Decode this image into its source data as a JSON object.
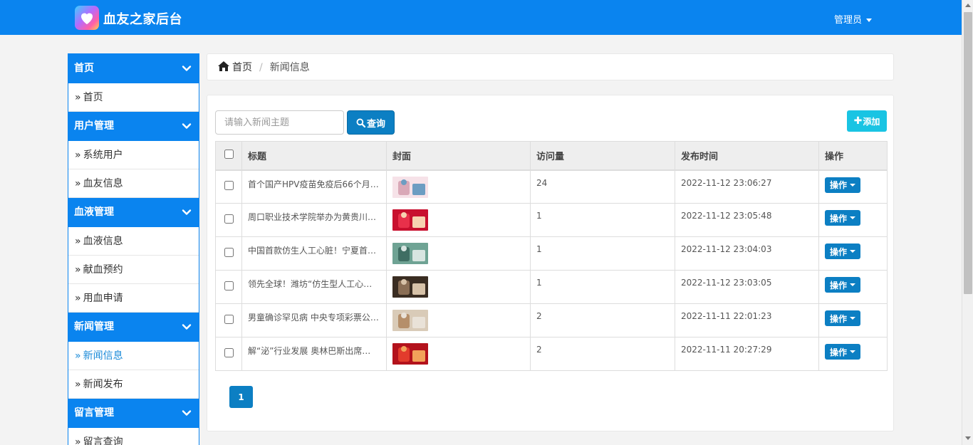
{
  "header": {
    "brand": "血友之家后台",
    "admin_label": "管理员"
  },
  "sidebar": {
    "sections": [
      {
        "title": "首页",
        "items": [
          {
            "label": "首页"
          }
        ]
      },
      {
        "title": "用户管理",
        "items": [
          {
            "label": "系统用户"
          },
          {
            "label": "血友信息"
          }
        ]
      },
      {
        "title": "血液管理",
        "items": [
          {
            "label": "血液信息"
          },
          {
            "label": "献血预约"
          },
          {
            "label": "用血申请"
          }
        ]
      },
      {
        "title": "新闻管理",
        "items": [
          {
            "label": "新闻信息"
          },
          {
            "label": "新闻发布"
          }
        ]
      },
      {
        "title": "留言管理",
        "items": [
          {
            "label": "留言查询"
          }
        ]
      }
    ],
    "item_prefix": "»"
  },
  "breadcrumb": {
    "home": "首页",
    "current": "新闻信息"
  },
  "toolbar": {
    "search_placeholder": "请输入新闻主题",
    "search_label": "查询",
    "add_label": "添加"
  },
  "table": {
    "headers": {
      "title": "标题",
      "cover": "封面",
      "visits": "访问量",
      "published": "发布时间",
      "actions": "操作"
    },
    "action_label": "操作",
    "rows": [
      {
        "title": "首个国产HPV疫苗免疫后66个月…",
        "visits": "24",
        "published": "2022-11-12 23:06:27",
        "thumb_colors": [
          "#f6e2e8",
          "#d9a8b7",
          "#6c9dc2"
        ]
      },
      {
        "title": "周口职业技术学院举办为黄贵川…",
        "visits": "1",
        "published": "2022-11-12 23:05:48",
        "thumb_colors": [
          "#c8102e",
          "#e8304a",
          "#f7d2b0"
        ]
      },
      {
        "title": "中国首款仿生人工心脏！宁夏首…",
        "visits": "1",
        "published": "2022-11-12 23:04:03",
        "thumb_colors": [
          "#6fa394",
          "#3f6e63",
          "#d8e5e1"
        ]
      },
      {
        "title": "领先全球！潍坊“仿生型人工心…",
        "visits": "1",
        "published": "2022-11-12 23:03:05",
        "thumb_colors": [
          "#3a2d22",
          "#8a6e55",
          "#d7c2a8"
        ]
      },
      {
        "title": "男童确诊罕见病 中央专项彩票公…",
        "visits": "2",
        "published": "2022-11-11 22:01:23",
        "thumb_colors": [
          "#d9cbb8",
          "#b58f6a",
          "#e9e2d8"
        ]
      },
      {
        "title": "解“泌”行业发展 奥林巴斯出席…",
        "visits": "2",
        "published": "2022-11-11 20:27:29",
        "thumb_colors": [
          "#b3121c",
          "#e23b2c",
          "#f2a25a"
        ]
      }
    ]
  },
  "pagination": {
    "current": "1"
  },
  "colors": {
    "primary": "#0a84ef",
    "button": "#0c7fc3",
    "add": "#19c4e3"
  }
}
